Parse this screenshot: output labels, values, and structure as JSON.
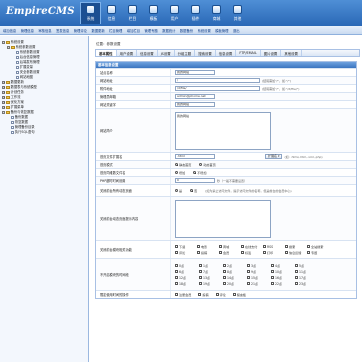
{
  "app": {
    "logo": "EmpireCMS"
  },
  "topnav": [
    {
      "label": "系统",
      "active": true
    },
    {
      "label": "信息",
      "active": false
    },
    {
      "label": "栏目",
      "active": false
    },
    {
      "label": "模板",
      "active": false
    },
    {
      "label": "用户",
      "active": false
    },
    {
      "label": "插件",
      "active": false
    },
    {
      "label": "商城",
      "active": false
    },
    {
      "label": "其他",
      "active": false
    }
  ],
  "subbar": [
    "增加信息",
    "管理信息",
    "审核信息",
    "签发信息",
    "管理评论",
    "数据更新",
    "栏目管理",
    "增加栏目",
    "管理专题",
    "数据统计",
    "数据备份",
    "系统设置",
    "模板管理",
    "退出"
  ],
  "sidebar": {
    "items": [
      {
        "label": "系统设置",
        "icon": "folder-icon",
        "box": "-",
        "indent": 0
      },
      {
        "label": "系统参数设置",
        "icon": "folder-icon",
        "box": "-",
        "indent": 1
      },
      {
        "label": "系统参数设置",
        "icon": "document-icon",
        "box": "",
        "indent": 2
      },
      {
        "label": "后台信息管理",
        "icon": "document-icon",
        "box": "",
        "indent": 2
      },
      {
        "label": "后端发布管理",
        "icon": "document-icon",
        "box": "",
        "indent": 2
      },
      {
        "label": "扩展变量",
        "icon": "document-icon",
        "box": "",
        "indent": 2
      },
      {
        "label": "安全参数设置",
        "icon": "document-icon",
        "box": "",
        "indent": 2
      },
      {
        "label": "网站地图",
        "icon": "document-icon",
        "box": "",
        "indent": 2
      },
      {
        "label": "数据更新",
        "icon": "folder-icon",
        "box": "+",
        "indent": 0
      },
      {
        "label": "数据表与系统模型",
        "icon": "folder-icon",
        "box": "+",
        "indent": 0
      },
      {
        "label": "计划任务",
        "icon": "folder-icon",
        "box": "+",
        "indent": 0
      },
      {
        "label": "工作流",
        "icon": "folder-icon",
        "box": "+",
        "indent": 0
      },
      {
        "label": "优化方案",
        "icon": "folder-icon",
        "box": "+",
        "indent": 0
      },
      {
        "label": "扩展菜单",
        "icon": "folder-icon",
        "box": "+",
        "indent": 0
      },
      {
        "label": "备份与恢复数据",
        "icon": "folder-icon",
        "box": "-",
        "indent": 0
      },
      {
        "label": "备份数据",
        "icon": "document-icon",
        "box": "",
        "indent": 1
      },
      {
        "label": "恢复数据",
        "icon": "document-icon",
        "box": "",
        "indent": 1
      },
      {
        "label": "管理备份目录",
        "icon": "document-icon",
        "box": "",
        "indent": 1
      },
      {
        "label": "执行SQL语句",
        "icon": "document-icon",
        "box": "",
        "indent": 1
      }
    ]
  },
  "main": {
    "breadcrumb": {
      "prefix": "位置：",
      "current": "参数设置"
    },
    "tabs": [
      {
        "label": "基本属性",
        "active": true
      },
      {
        "label": "用户设置",
        "active": false
      },
      {
        "label": "信息设置",
        "active": false
      },
      {
        "label": "JS设置",
        "active": false
      },
      {
        "label": "分组主题",
        "active": false
      },
      {
        "label": "搜索设置",
        "active": false
      },
      {
        "label": "信息设置",
        "active": false
      },
      {
        "label": "FTP/EMAIL",
        "active": false
      },
      {
        "label": "图片设置",
        "active": false
      },
      {
        "label": "其他设置",
        "active": false
      }
    ],
    "form_header": "基本信息设置",
    "fields": {
      "site_name": {
        "label": "站点名称",
        "value": "我的网站"
      },
      "site_url": {
        "label": "网站地址",
        "value": "/",
        "hint": "(结尾需加\"/\"，如:\"/\")"
      },
      "attach_url": {
        "label": "附件地址",
        "value": "/d/file/",
        "hint": "(结尾需加\"/\"，如:\"/d/file/\")"
      },
      "admin_email": {
        "label": "管理员邮箱",
        "value": "admin@phome.net"
      },
      "keywords": {
        "label": "网站关键字",
        "value": "我的网站"
      },
      "description": {
        "label": "网站简介",
        "value": "我的网站"
      },
      "index_ext": {
        "label": "首页文件扩展名",
        "value": ".html",
        "select": "扩展名",
        "hint": "(如: .html,.htm,.xml,.php)"
      },
      "index_mode": {
        "label": "首页模式",
        "options": [
          "静态首页",
          "动态首页"
        ],
        "selected": 0
      },
      "index_file": {
        "label": "首页同维数文件名",
        "options": [
          "增加",
          "不增加"
        ],
        "selected": 1
      },
      "php_timeout": {
        "label": "PHP超时时间设置",
        "value": "0",
        "hint": "秒（一般不需要设置）"
      },
      "close_site": {
        "label": "关闭前台所有动态页面",
        "options": [
          "是",
          "否"
        ],
        "selected": 1,
        "hint": "(如为禁止访问文件，提示访问文件的名称，但是前台的会员中心)"
      },
      "close_prompt": {
        "label": "关闭前台动态页面提示内容",
        "value": ""
      },
      "close_modules": {
        "label": "关闭前台模块相关功能",
        "options": [
          "下载",
          "电影",
          "商城",
          "在线支付",
          "RSS",
          "搜索",
          "全站搜索",
          "评论",
          "投稿",
          "会员",
          "标签",
          "打印",
          "信息反馈",
          "专题"
        ]
      },
      "no_search_cols": {
        "label": "不开启模块的时间段",
        "options": [
          "0点",
          "1点",
          "2点",
          "3点",
          "4点",
          "5点",
          "6点",
          "7点",
          "8点",
          "9点",
          "10点",
          "11点",
          "12点",
          "13点",
          "14点",
          "15点",
          "16点",
          "17点",
          "18点",
          "19点",
          "20点",
          "21点",
          "22点",
          "23点"
        ]
      },
      "time_limit": {
        "label": "限定使用时间的操作",
        "options": [
          "注册会员",
          "投稿",
          "评论",
          "留言板"
        ]
      }
    }
  }
}
